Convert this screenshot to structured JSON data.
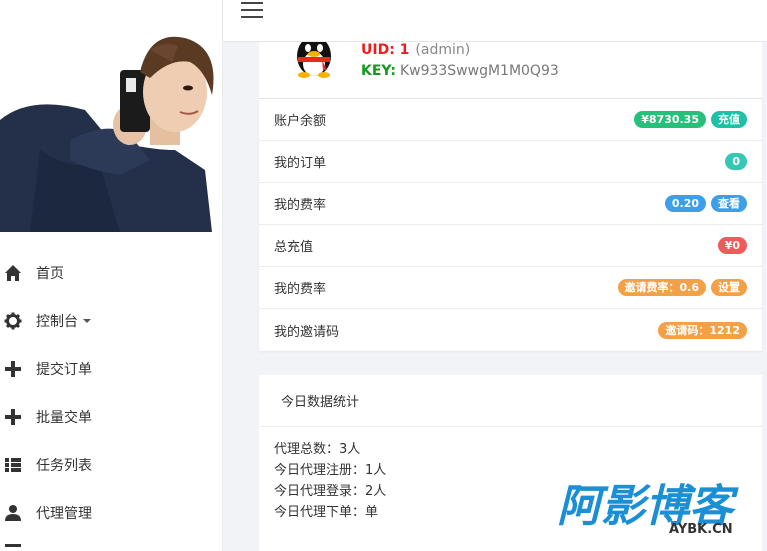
{
  "sidebar": {
    "avatar_alt": "user photo",
    "items": [
      {
        "label": "首页",
        "icon": "home-icon"
      },
      {
        "label": "控制台",
        "icon": "gear-icon",
        "has_caret": true
      },
      {
        "label": "提交订单",
        "icon": "plus-icon"
      },
      {
        "label": "批量交单",
        "icon": "plus-icon"
      },
      {
        "label": "任务列表",
        "icon": "list-icon"
      },
      {
        "label": "代理管理",
        "icon": "user-icon"
      }
    ]
  },
  "profile": {
    "uid_label": "UID: 1",
    "role": "(admin)",
    "key_label": "KEY:",
    "key_value": "Kw933SwwgM1M0Q93"
  },
  "list": [
    {
      "label": "账户余额",
      "badges": [
        {
          "text": "¥8730.35",
          "color": "#27c07a"
        },
        {
          "text": "充值",
          "color": "#1fc1a6"
        }
      ]
    },
    {
      "label": "我的订单",
      "badges": [
        {
          "text": "0",
          "color": "#34c8b4"
        }
      ]
    },
    {
      "label": "我的费率",
      "badges": [
        {
          "text": "0.20",
          "color": "#3d9fe8"
        },
        {
          "text": "查看",
          "color": "#3d9fe8"
        }
      ]
    },
    {
      "label": "总充值",
      "badges": [
        {
          "text": "¥0",
          "color": "#ef5b5b"
        }
      ]
    },
    {
      "label": "我的费率",
      "badges": [
        {
          "text": "邀请费率：0.6",
          "color": "#f3a047"
        },
        {
          "text": "设置",
          "color": "#f3a047"
        }
      ]
    },
    {
      "label": "我的邀请码",
      "badges": [
        {
          "text": "邀请码：1212",
          "color": "#f3a047"
        }
      ]
    }
  ],
  "stats": {
    "title": "今日数据统计",
    "lines": [
      "代理总数：3人",
      "今日代理注册：1人",
      "今日代理登录：2人",
      "今日代理下单：单"
    ]
  },
  "watermark": {
    "text_main": "阿影博客",
    "text_sub": "AYBK.CN",
    "color": "#1a8fd6"
  }
}
